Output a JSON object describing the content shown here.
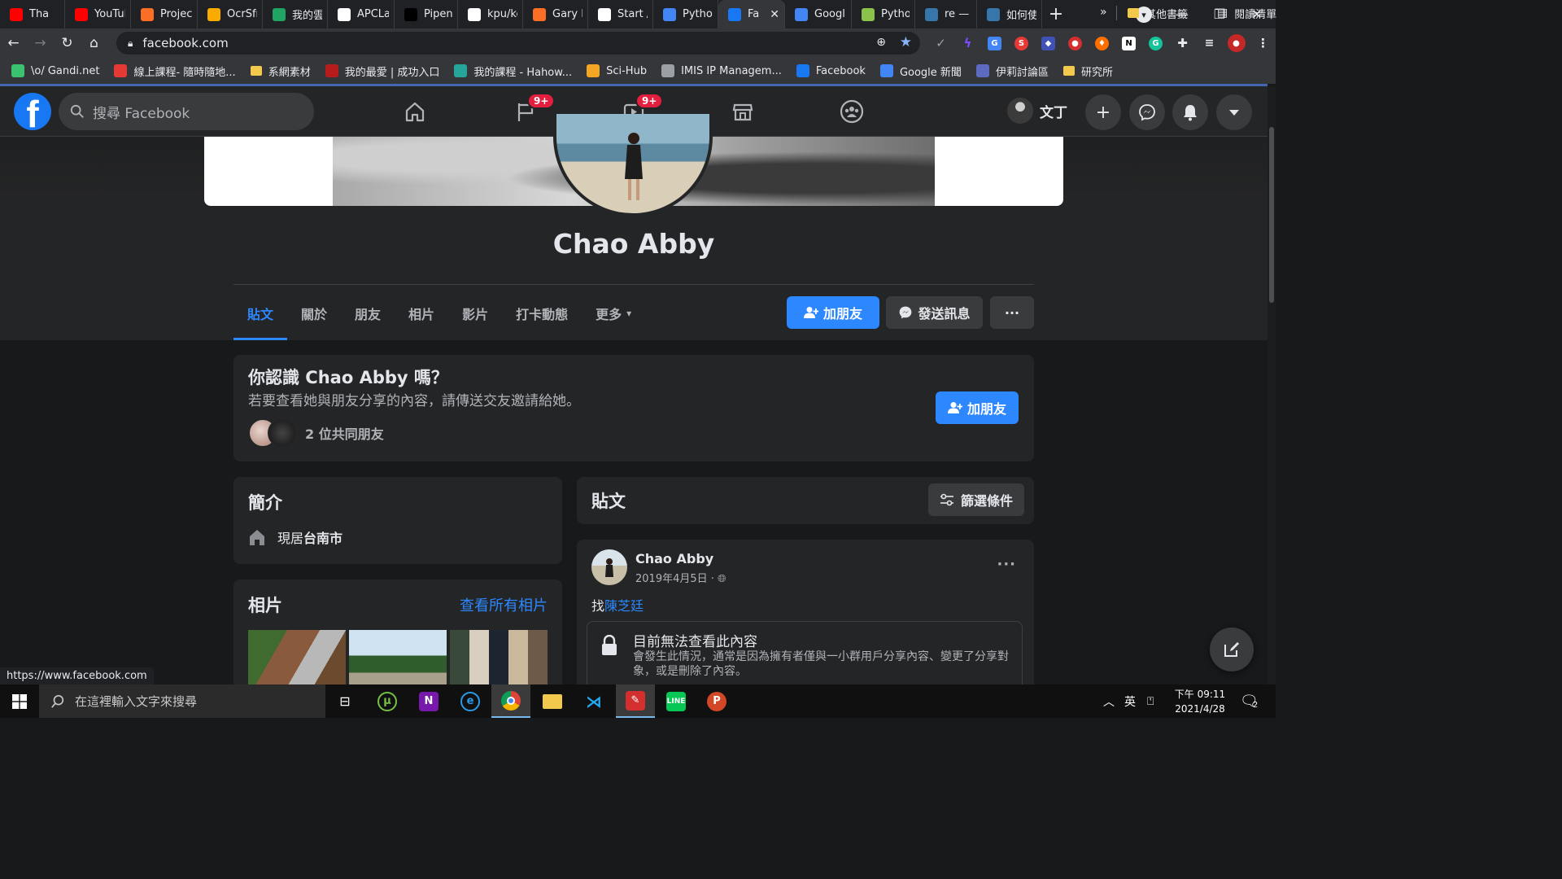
{
  "browser": {
    "tabs": [
      {
        "label": "Tha",
        "icon": "youtube-icon",
        "color": "#ff0000",
        "width": 80
      },
      {
        "label": "YouTul",
        "icon": "youtube-icon",
        "color": "#ff0000",
        "width": 81
      },
      {
        "label": "Project",
        "icon": "gitlab-icon",
        "color": "#fc6d26",
        "width": 82
      },
      {
        "label": "OcrSfrs",
        "icon": "colab-icon",
        "color": "#f9ab00",
        "width": 80
      },
      {
        "label": "我的雲",
        "icon": "google-drive-icon",
        "color": "#1fa463",
        "width": 80
      },
      {
        "label": "APCLa",
        "icon": "github-icon",
        "color": "#ffffff",
        "width": 82
      },
      {
        "label": "Pipenv",
        "icon": "medium-icon",
        "color": "#000000",
        "width": 78
      },
      {
        "label": "kpu/ke",
        "icon": "github-icon",
        "color": "#ffffff",
        "width": 80
      },
      {
        "label": "Gary Le",
        "icon": "gitlab-icon",
        "color": "#fc6d26",
        "width": 80
      },
      {
        "label": "Start /",
        "icon": "page-icon",
        "color": "#ffffff",
        "width": 80
      },
      {
        "label": "Pythor",
        "icon": "google-docs-icon",
        "color": "#4285f4",
        "width": 80
      },
      {
        "label": "Fac",
        "icon": "facebook-icon",
        "color": "#1877f2",
        "width": 82,
        "active": true
      },
      {
        "label": "Googl",
        "icon": "google-news-icon",
        "color": "#4285f4",
        "width": 82
      },
      {
        "label": "Pythor",
        "icon": "python-icon",
        "color": "#8bc34a",
        "width": 78
      },
      {
        "label": "re — R",
        "icon": "python-icon",
        "color": "#3776ab",
        "width": 76
      },
      {
        "label": "如何使",
        "icon": "python-icon",
        "color": "#3776ab",
        "width": 80
      }
    ],
    "new_tab": "+",
    "close_tab": "✕",
    "url": "facebook.com",
    "bookmarks": [
      {
        "label": "\\o/ Gandi.net",
        "icon": "gandi-icon",
        "color": "#3ac26e"
      },
      {
        "label": "線上課程- 隨時隨地...",
        "icon": "course-icon",
        "color": "#e53935"
      },
      {
        "label": "系網素材",
        "icon": "folder-icon",
        "color": "#f2c94c"
      },
      {
        "label": "我的最愛 | 成功入口",
        "icon": "ncku-icon",
        "color": "#b71c1c"
      },
      {
        "label": "我的課程 - Hahow...",
        "icon": "hahow-icon",
        "color": "#26a69a"
      },
      {
        "label": "Sci-Hub",
        "icon": "scihub-icon",
        "color": "#f5a623"
      },
      {
        "label": "IMIS IP Managem...",
        "icon": "globe-icon",
        "color": "#9aa0a6"
      },
      {
        "label": "Facebook",
        "icon": "facebook-icon",
        "color": "#1877f2"
      },
      {
        "label": "Google 新聞",
        "icon": "google-news-icon",
        "color": "#4285f4"
      },
      {
        "label": "伊莉討論區",
        "icon": "eyny-icon",
        "color": "#5c6bc0"
      },
      {
        "label": "研究所",
        "icon": "folder-icon",
        "color": "#f2c94c"
      }
    ],
    "bookmarks_more": "»",
    "other_bookmarks": "其他書籤",
    "reading_list": "閱讀清單",
    "status_url": "https://www.facebook.com"
  },
  "facebook": {
    "search_placeholder": "搜尋 Facebook",
    "badge_pages": "9+",
    "badge_watch": "9+",
    "user_name": "文丁",
    "profile_name": "Chao Abby",
    "tabs": [
      "貼文",
      "關於",
      "朋友",
      "相片",
      "影片",
      "打卡動態",
      "更多"
    ],
    "add_friend": "加朋友",
    "send_message": "發送訊息",
    "more_actions": "···",
    "know_title": "你認識 Chao Abby 嗎？",
    "know_subtitle": "若要查看她與朋友分享的內容，請傳送交友邀請給她。",
    "mutual_friends": "2 位共同朋友",
    "intro_title": "簡介",
    "intro_lives_prefix": "現居",
    "intro_city": "台南市",
    "photos_title": "相片",
    "see_all_photos": "查看所有相片",
    "posts_title": "貼文",
    "filter_label": "篩選條件",
    "post": {
      "author": "Chao Abby",
      "date": "2019年4月5日",
      "date_sep": "·",
      "text_prefix": "找",
      "tagged": "陳芝廷",
      "locked_title": "目前無法查看此內容",
      "locked_desc": "會發生此情況，通常是因為擁有者僅與一小群用戶分享內容、變更了分享對象，或是刪除了內容。"
    }
  },
  "taskbar": {
    "search_placeholder": "在這裡輸入文字來搜尋",
    "ime_lang": "英",
    "time": "下午 09:11",
    "date": "2021/4/28",
    "notification_count": "2"
  },
  "colors": {
    "fb_blue": "#2d88ff",
    "fb_bg": "#18191a",
    "fb_card": "#242526",
    "badge_red": "#e41e3f"
  }
}
